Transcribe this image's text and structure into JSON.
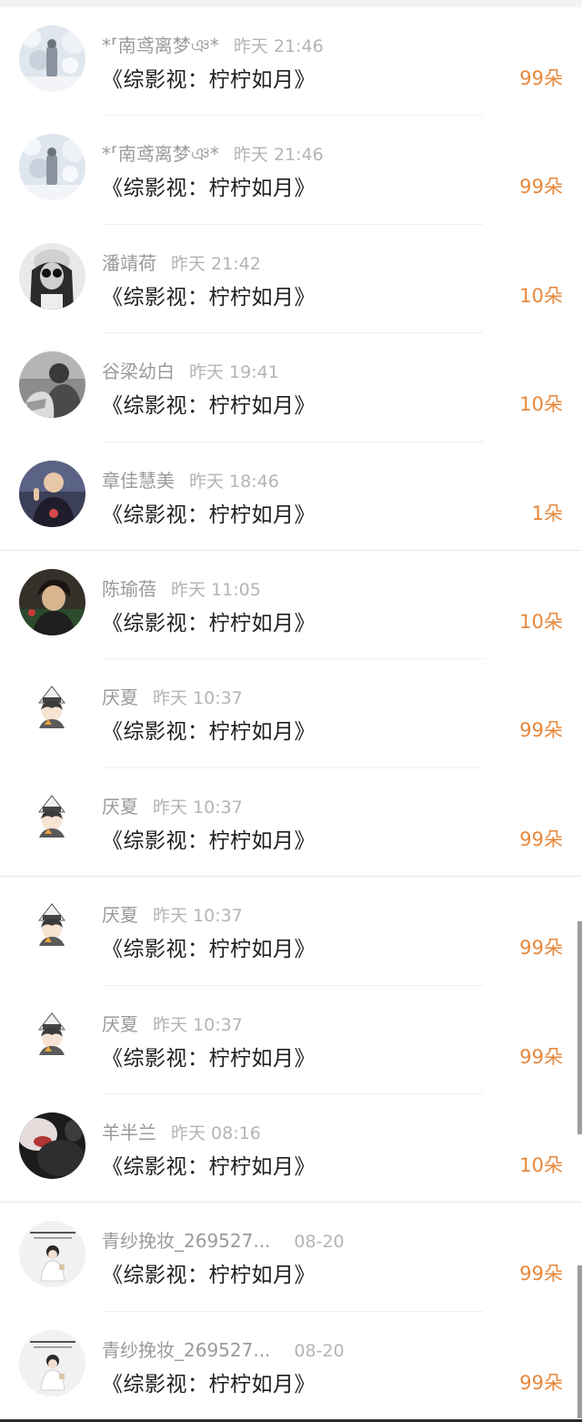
{
  "rows": [
    {
      "name": "*⸢南鸢离梦ঞ*",
      "time": "昨天 21:46",
      "title": "《综影视：柠柠如月》",
      "amount": "99朵",
      "avatar_icon": "snow-scene-portrait-avatar-icon"
    },
    {
      "name": "*⸢南鸢离梦ঞ*",
      "time": "昨天 21:46",
      "title": "《综影视：柠柠如月》",
      "amount": "99朵",
      "avatar_icon": "snow-scene-portrait-avatar-icon"
    },
    {
      "name": "潘靖荷",
      "time": "昨天 21:42",
      "title": "《综影视：柠柠如月》",
      "amount": "10朵",
      "avatar_icon": "sunglasses-woman-avatar-icon"
    },
    {
      "name": "谷梁幼白",
      "time": "昨天 19:41",
      "title": "《综影视：柠柠如月》",
      "amount": "10朵",
      "avatar_icon": "couple-photo-avatar-icon"
    },
    {
      "name": "章佳慧美",
      "time": "昨天 18:46",
      "title": "《综影视：柠柠如月》",
      "amount": "1朵",
      "avatar_icon": "child-photo-avatar-icon"
    },
    {
      "name": "陈瑜蓓",
      "time": "昨天 11:05",
      "title": "《综影视：柠柠如月》",
      "amount": "10朵",
      "avatar_icon": "boy-portrait-avatar-icon"
    },
    {
      "name": "厌夏",
      "time": "昨天 10:37",
      "title": "《综影视：柠柠如月》",
      "amount": "99朵",
      "avatar_icon": "cartoon-character-avatar-icon"
    },
    {
      "name": "厌夏",
      "time": "昨天 10:37",
      "title": "《综影视：柠柠如月》",
      "amount": "99朵",
      "avatar_icon": "cartoon-character-avatar-icon"
    },
    {
      "name": "厌夏",
      "time": "昨天 10:37",
      "title": "《综影视：柠柠如月》",
      "amount": "99朵",
      "avatar_icon": "cartoon-character-avatar-icon"
    },
    {
      "name": "厌夏",
      "time": "昨天 10:37",
      "title": "《综影视：柠柠如月》",
      "amount": "99朵",
      "avatar_icon": "cartoon-character-avatar-icon"
    },
    {
      "name": "羊半兰",
      "time": "昨天 08:16",
      "title": "《综影视：柠柠如月》",
      "amount": "10朵",
      "avatar_icon": "dark-photo-avatar-icon"
    },
    {
      "name": "青纱挽妆_269527...",
      "time": "08-20",
      "title": "《综影视：柠柠如月》",
      "amount": "99朵",
      "avatar_icon": "illustrated-girl-avatar-icon"
    },
    {
      "name": "青纱挽妆_269527...",
      "time": "08-20",
      "title": "《综影视：柠柠如月》",
      "amount": "99朵",
      "avatar_icon": "illustrated-girl-avatar-icon"
    }
  ],
  "colors": {
    "amount": "#e8873a",
    "name": "#9a9a9a",
    "time": "#b4b4b4",
    "title": "#1e1e1e"
  }
}
